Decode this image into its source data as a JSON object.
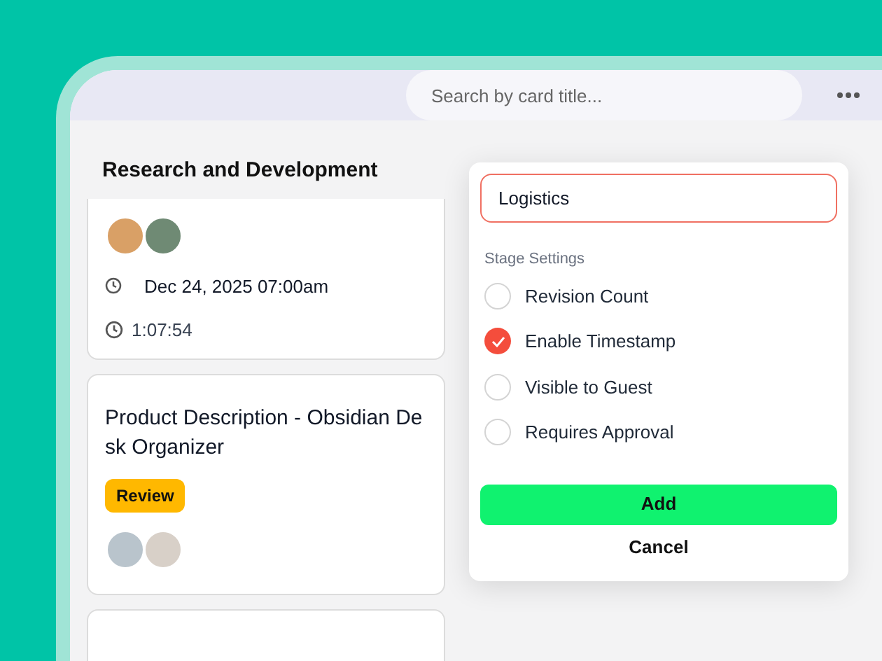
{
  "search": {
    "placeholder": "Search by card title..."
  },
  "column": {
    "title": "Research and Development",
    "cards": [
      {
        "kind": "cut_top",
        "avatars": [
          {
            "color": "#d9a066"
          },
          {
            "color": "#6f8a74"
          }
        ],
        "due": "Dec 24, 2025 07:00am",
        "timer": "1:07:54"
      },
      {
        "kind": "full",
        "title": "Product Description - Obsidian De sk Organizer",
        "tag": "Review",
        "avatars": [
          {
            "color": "#b9c4cc"
          },
          {
            "color": "#d8d0c8"
          }
        ]
      },
      {
        "kind": "cut_bottom"
      }
    ]
  },
  "popup": {
    "name_value": "Logistics",
    "section_label": "Stage Settings",
    "options": [
      {
        "label": "Revision Count",
        "checked": false
      },
      {
        "label": "Enable Timestamp",
        "checked": true
      },
      {
        "label": "Visible to Guest",
        "checked": false
      },
      {
        "label": "Requires Approval",
        "checked": false
      }
    ],
    "primary_button": "Add",
    "secondary_button": "Cancel"
  }
}
